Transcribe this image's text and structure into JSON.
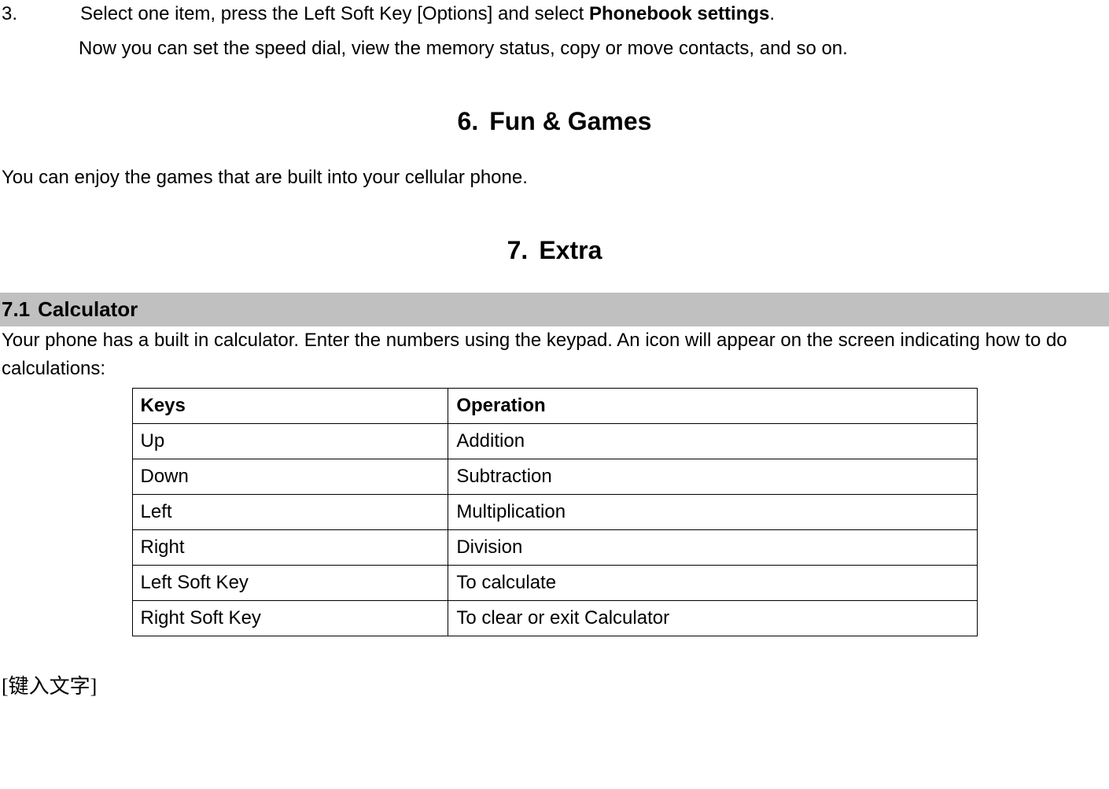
{
  "listItem": {
    "number": "3.",
    "line1_pre": "Select one item, press the Left Soft Key [Options] and select ",
    "line1_bold": "Phonebook settings",
    "line1_post": ".",
    "line2": "Now you can set the speed dial, view the memory status, copy or move contacts, and so on."
  },
  "section6": {
    "num": "6.",
    "title": "Fun & Games",
    "body": "You can enjoy the games that are built into your cellular phone."
  },
  "section7": {
    "num": "7.",
    "title": "Extra"
  },
  "sub7_1": {
    "num": "7.1",
    "title": "Calculator",
    "body": "Your phone has a built in calculator. Enter the numbers using the keypad. An icon will appear on the screen indicating how to do calculations:"
  },
  "table": {
    "headers": {
      "col1": "Keys",
      "col2": "Operation"
    },
    "rows": [
      {
        "key": "Up",
        "op": "Addition"
      },
      {
        "key": "Down",
        "op": "Subtraction"
      },
      {
        "key": "Left",
        "op": "Multiplication"
      },
      {
        "key": "Right",
        "op": "Division"
      },
      {
        "key": "Left Soft Key",
        "op": "To calculate"
      },
      {
        "key": "Right Soft Key",
        "op": "To clear or exit Calculator"
      }
    ]
  },
  "footer": "[键入文字]"
}
